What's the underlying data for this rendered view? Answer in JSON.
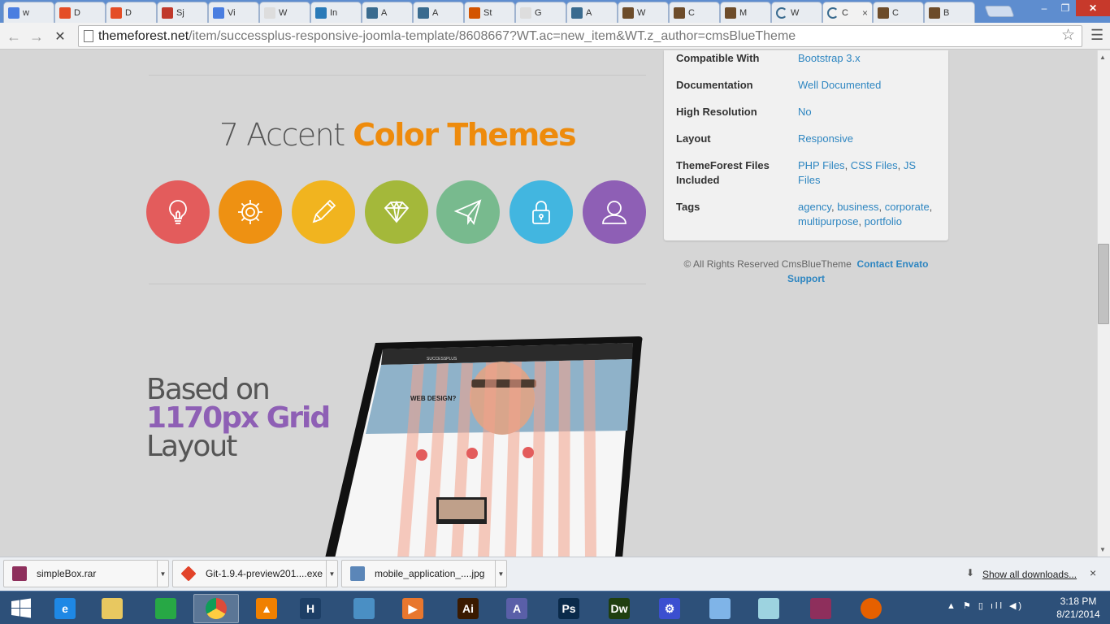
{
  "browser": {
    "tabs": [
      {
        "label": "w",
        "icon": "google-icon",
        "color": "#4a7ee0"
      },
      {
        "label": "D",
        "icon": "windows-icon",
        "color": "#e44d26"
      },
      {
        "label": "D",
        "icon": "windows-icon",
        "color": "#e44d26"
      },
      {
        "label": "Sj",
        "icon": "app-icon",
        "color": "#c0392b"
      },
      {
        "label": "Vi",
        "icon": "google-icon",
        "color": "#4a7ee0"
      },
      {
        "label": "W",
        "icon": "page-icon",
        "color": "#dddddd"
      },
      {
        "label": "In",
        "icon": "dell-icon",
        "color": "#2a7ab8"
      },
      {
        "label": "A",
        "icon": "globe-icon",
        "color": "#3a6b8f"
      },
      {
        "label": "A",
        "icon": "globe-icon",
        "color": "#3a6b8f"
      },
      {
        "label": "St",
        "icon": "x-icon",
        "color": "#d35400"
      },
      {
        "label": "G",
        "icon": "page-icon",
        "color": "#dddddd"
      },
      {
        "label": "A",
        "icon": "globe-icon",
        "color": "#3a6b8f"
      },
      {
        "label": "W",
        "icon": "book-icon",
        "color": "#6d4c2a"
      },
      {
        "label": "C",
        "icon": "book-icon",
        "color": "#6d4c2a"
      },
      {
        "label": "M",
        "icon": "book-icon",
        "color": "#6d4c2a"
      },
      {
        "label": "W",
        "icon": "loading-icon",
        "color": "#3a6b8f"
      },
      {
        "label": "C",
        "icon": "loading-icon",
        "color": "#3a6b8f",
        "active": true,
        "close": "×"
      },
      {
        "label": "C",
        "icon": "book-icon",
        "color": "#6d4c2a"
      },
      {
        "label": "B",
        "icon": "book-icon",
        "color": "#6d4c2a"
      }
    ],
    "url_host": "themeforest.net",
    "url_path": "/item/successplus-responsive-joomla-template/8608667?WT.ac=new_item&WT.z_author=cmsBlueTheme",
    "window_buttons": {
      "min": "–",
      "max": "❐",
      "close": "✕"
    }
  },
  "page": {
    "accent_heading": {
      "plain": "7 Accent ",
      "highlight": "Color Themes"
    },
    "color_circles": [
      {
        "name": "lightbulb-icon",
        "color": "#e35c5c"
      },
      {
        "name": "gear-icon",
        "color": "#ee9112"
      },
      {
        "name": "pencil-icon",
        "color": "#f1b41f"
      },
      {
        "name": "diamond-icon",
        "color": "#a4b83a"
      },
      {
        "name": "paper-plane-icon",
        "color": "#78ba8e"
      },
      {
        "name": "lock-icon",
        "color": "#42b6e0"
      },
      {
        "name": "user-icon",
        "color": "#8e5fb5"
      }
    ],
    "grid_heading": {
      "line1": "Based on",
      "line2": "1170px Grid",
      "line3": "Layout"
    },
    "laptop_screen": {
      "brand": "SUCCESSPLUS",
      "hero": "WEB DESIGN?"
    }
  },
  "sidebar": {
    "rows": [
      {
        "label": "Compatible With",
        "values": [
          "Bootstrap 3.x"
        ]
      },
      {
        "label": "Documentation",
        "values": [
          "Well Documented"
        ]
      },
      {
        "label": "High Resolution",
        "values": [
          "No"
        ]
      },
      {
        "label": "Layout",
        "values": [
          "Responsive"
        ]
      },
      {
        "label": "ThemeForest Files Included",
        "values": [
          "PHP Files",
          "CSS Files",
          "JS Files"
        ]
      },
      {
        "label": "Tags",
        "values": [
          "agency",
          "business",
          "corporate",
          "multipurpose",
          "portfolio"
        ]
      }
    ],
    "footer_text": "© All Rights Reserved CmsBlueTheme",
    "footer_link": "Contact Envato Support"
  },
  "downloads": {
    "items": [
      {
        "name": "simpleBox.rar",
        "icon": "winrar-icon",
        "color": "#8e2f5c"
      },
      {
        "name": "Git-1.9.4-preview201....exe",
        "icon": "git-icon",
        "color": "#e24329"
      },
      {
        "name": "mobile_application_....jpg",
        "icon": "image-icon",
        "color": "#5b86b8"
      }
    ],
    "show_all": "Show all downloads...",
    "close": "×"
  },
  "taskbar": {
    "apps": [
      {
        "name": "internet-explorer-icon",
        "glyph": "e",
        "color": "#1e88e5"
      },
      {
        "name": "file-explorer-icon",
        "glyph": "",
        "color": "#e8c860"
      },
      {
        "name": "store-icon",
        "glyph": "",
        "color": "#27a845"
      },
      {
        "name": "chrome-icon",
        "glyph": "",
        "color": "#dd4b39",
        "active": true
      },
      {
        "name": "vlc-icon",
        "glyph": "▲",
        "color": "#f08000"
      },
      {
        "name": "app-h-icon",
        "glyph": "H",
        "color": "#1d3f66"
      },
      {
        "name": "photos-icon",
        "glyph": "",
        "color": "#4a8fc4"
      },
      {
        "name": "media-icon",
        "glyph": "▶",
        "color": "#e8772e"
      },
      {
        "name": "illustrator-icon",
        "glyph": "Ai",
        "color": "#3a1a00"
      },
      {
        "name": "triangle-app-icon",
        "glyph": "A",
        "color": "#5a5fa8"
      },
      {
        "name": "photoshop-icon",
        "glyph": "Ps",
        "color": "#0a2a4a"
      },
      {
        "name": "dreamweaver-icon",
        "glyph": "Dw",
        "color": "#1f3f0f"
      },
      {
        "name": "settings-icon",
        "glyph": "⚙",
        "color": "#3b4fd0"
      },
      {
        "name": "control-panel-icon",
        "glyph": "",
        "color": "#7fb4e8"
      },
      {
        "name": "notepad-icon",
        "glyph": "",
        "color": "#9dd3e0"
      },
      {
        "name": "winrar-icon",
        "glyph": "",
        "color": "#8e2f5c"
      },
      {
        "name": "firefox-icon",
        "glyph": "",
        "color": "#e66000"
      }
    ],
    "time": "3:18 PM",
    "date": "8/21/2014"
  }
}
